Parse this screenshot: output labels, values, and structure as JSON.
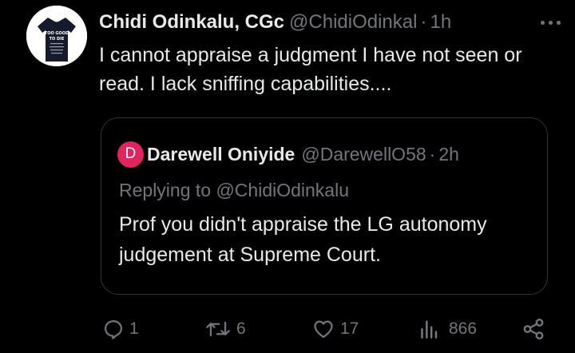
{
  "tweet": {
    "author_name": "Chidi Odinkalu, CGc",
    "handle": "@ChidiOdinkal",
    "separator": "·",
    "time": "1h",
    "avatar_icon": "tshirt-avatar-icon",
    "avatar_text": "TOO GOOD TO DIE",
    "text": "I cannot appraise a judgment I have not seen or read. I lack sniffing capabilities...."
  },
  "quote": {
    "avatar_letter": "D",
    "avatar_color": "#e0245e",
    "author_name": "Darewell Oniyide",
    "handle": "@DarewellO58",
    "separator": "·",
    "time": "2h",
    "replying_to": "Replying to @ChidiOdinkalu",
    "text": "Prof  you didn't appraise the LG autonomy judgement at Supreme Court."
  },
  "actions": {
    "reply_count": "1",
    "retweet_count": "6",
    "like_count": "17",
    "views_count": "866"
  },
  "colors": {
    "background": "#000000",
    "text": "#e7e9ea",
    "muted": "#71767b",
    "border": "#2f3336"
  }
}
